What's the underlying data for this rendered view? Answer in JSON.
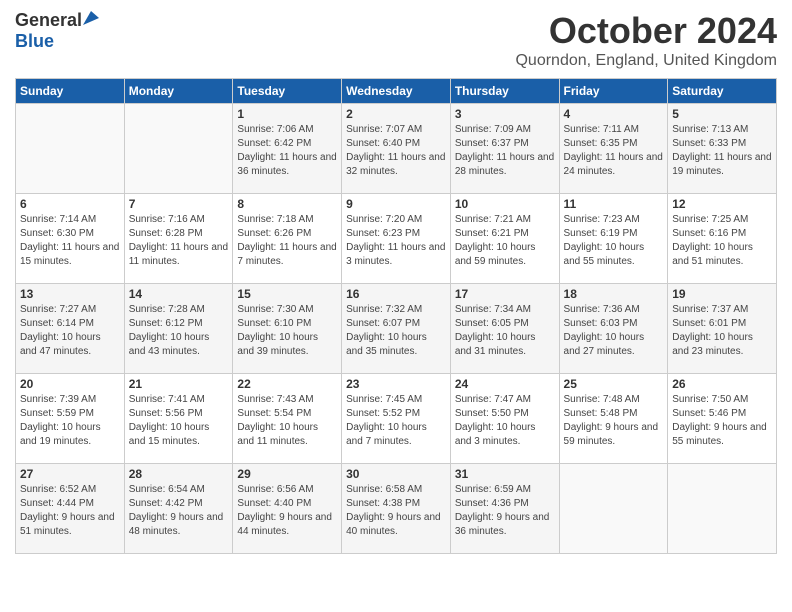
{
  "header": {
    "logo_general": "General",
    "logo_blue": "Blue",
    "month_title": "October 2024",
    "location": "Quorndon, England, United Kingdom"
  },
  "days_of_week": [
    "Sunday",
    "Monday",
    "Tuesday",
    "Wednesday",
    "Thursday",
    "Friday",
    "Saturday"
  ],
  "weeks": [
    [
      {
        "day": "",
        "sunrise": "",
        "sunset": "",
        "daylight": ""
      },
      {
        "day": "",
        "sunrise": "",
        "sunset": "",
        "daylight": ""
      },
      {
        "day": "1",
        "sunrise": "Sunrise: 7:06 AM",
        "sunset": "Sunset: 6:42 PM",
        "daylight": "Daylight: 11 hours and 36 minutes."
      },
      {
        "day": "2",
        "sunrise": "Sunrise: 7:07 AM",
        "sunset": "Sunset: 6:40 PM",
        "daylight": "Daylight: 11 hours and 32 minutes."
      },
      {
        "day": "3",
        "sunrise": "Sunrise: 7:09 AM",
        "sunset": "Sunset: 6:37 PM",
        "daylight": "Daylight: 11 hours and 28 minutes."
      },
      {
        "day": "4",
        "sunrise": "Sunrise: 7:11 AM",
        "sunset": "Sunset: 6:35 PM",
        "daylight": "Daylight: 11 hours and 24 minutes."
      },
      {
        "day": "5",
        "sunrise": "Sunrise: 7:13 AM",
        "sunset": "Sunset: 6:33 PM",
        "daylight": "Daylight: 11 hours and 19 minutes."
      }
    ],
    [
      {
        "day": "6",
        "sunrise": "Sunrise: 7:14 AM",
        "sunset": "Sunset: 6:30 PM",
        "daylight": "Daylight: 11 hours and 15 minutes."
      },
      {
        "day": "7",
        "sunrise": "Sunrise: 7:16 AM",
        "sunset": "Sunset: 6:28 PM",
        "daylight": "Daylight: 11 hours and 11 minutes."
      },
      {
        "day": "8",
        "sunrise": "Sunrise: 7:18 AM",
        "sunset": "Sunset: 6:26 PM",
        "daylight": "Daylight: 11 hours and 7 minutes."
      },
      {
        "day": "9",
        "sunrise": "Sunrise: 7:20 AM",
        "sunset": "Sunset: 6:23 PM",
        "daylight": "Daylight: 11 hours and 3 minutes."
      },
      {
        "day": "10",
        "sunrise": "Sunrise: 7:21 AM",
        "sunset": "Sunset: 6:21 PM",
        "daylight": "Daylight: 10 hours and 59 minutes."
      },
      {
        "day": "11",
        "sunrise": "Sunrise: 7:23 AM",
        "sunset": "Sunset: 6:19 PM",
        "daylight": "Daylight: 10 hours and 55 minutes."
      },
      {
        "day": "12",
        "sunrise": "Sunrise: 7:25 AM",
        "sunset": "Sunset: 6:16 PM",
        "daylight": "Daylight: 10 hours and 51 minutes."
      }
    ],
    [
      {
        "day": "13",
        "sunrise": "Sunrise: 7:27 AM",
        "sunset": "Sunset: 6:14 PM",
        "daylight": "Daylight: 10 hours and 47 minutes."
      },
      {
        "day": "14",
        "sunrise": "Sunrise: 7:28 AM",
        "sunset": "Sunset: 6:12 PM",
        "daylight": "Daylight: 10 hours and 43 minutes."
      },
      {
        "day": "15",
        "sunrise": "Sunrise: 7:30 AM",
        "sunset": "Sunset: 6:10 PM",
        "daylight": "Daylight: 10 hours and 39 minutes."
      },
      {
        "day": "16",
        "sunrise": "Sunrise: 7:32 AM",
        "sunset": "Sunset: 6:07 PM",
        "daylight": "Daylight: 10 hours and 35 minutes."
      },
      {
        "day": "17",
        "sunrise": "Sunrise: 7:34 AM",
        "sunset": "Sunset: 6:05 PM",
        "daylight": "Daylight: 10 hours and 31 minutes."
      },
      {
        "day": "18",
        "sunrise": "Sunrise: 7:36 AM",
        "sunset": "Sunset: 6:03 PM",
        "daylight": "Daylight: 10 hours and 27 minutes."
      },
      {
        "day": "19",
        "sunrise": "Sunrise: 7:37 AM",
        "sunset": "Sunset: 6:01 PM",
        "daylight": "Daylight: 10 hours and 23 minutes."
      }
    ],
    [
      {
        "day": "20",
        "sunrise": "Sunrise: 7:39 AM",
        "sunset": "Sunset: 5:59 PM",
        "daylight": "Daylight: 10 hours and 19 minutes."
      },
      {
        "day": "21",
        "sunrise": "Sunrise: 7:41 AM",
        "sunset": "Sunset: 5:56 PM",
        "daylight": "Daylight: 10 hours and 15 minutes."
      },
      {
        "day": "22",
        "sunrise": "Sunrise: 7:43 AM",
        "sunset": "Sunset: 5:54 PM",
        "daylight": "Daylight: 10 hours and 11 minutes."
      },
      {
        "day": "23",
        "sunrise": "Sunrise: 7:45 AM",
        "sunset": "Sunset: 5:52 PM",
        "daylight": "Daylight: 10 hours and 7 minutes."
      },
      {
        "day": "24",
        "sunrise": "Sunrise: 7:47 AM",
        "sunset": "Sunset: 5:50 PM",
        "daylight": "Daylight: 10 hours and 3 minutes."
      },
      {
        "day": "25",
        "sunrise": "Sunrise: 7:48 AM",
        "sunset": "Sunset: 5:48 PM",
        "daylight": "Daylight: 9 hours and 59 minutes."
      },
      {
        "day": "26",
        "sunrise": "Sunrise: 7:50 AM",
        "sunset": "Sunset: 5:46 PM",
        "daylight": "Daylight: 9 hours and 55 minutes."
      }
    ],
    [
      {
        "day": "27",
        "sunrise": "Sunrise: 6:52 AM",
        "sunset": "Sunset: 4:44 PM",
        "daylight": "Daylight: 9 hours and 51 minutes."
      },
      {
        "day": "28",
        "sunrise": "Sunrise: 6:54 AM",
        "sunset": "Sunset: 4:42 PM",
        "daylight": "Daylight: 9 hours and 48 minutes."
      },
      {
        "day": "29",
        "sunrise": "Sunrise: 6:56 AM",
        "sunset": "Sunset: 4:40 PM",
        "daylight": "Daylight: 9 hours and 44 minutes."
      },
      {
        "day": "30",
        "sunrise": "Sunrise: 6:58 AM",
        "sunset": "Sunset: 4:38 PM",
        "daylight": "Daylight: 9 hours and 40 minutes."
      },
      {
        "day": "31",
        "sunrise": "Sunrise: 6:59 AM",
        "sunset": "Sunset: 4:36 PM",
        "daylight": "Daylight: 9 hours and 36 minutes."
      },
      {
        "day": "",
        "sunrise": "",
        "sunset": "",
        "daylight": ""
      },
      {
        "day": "",
        "sunrise": "",
        "sunset": "",
        "daylight": ""
      }
    ]
  ]
}
